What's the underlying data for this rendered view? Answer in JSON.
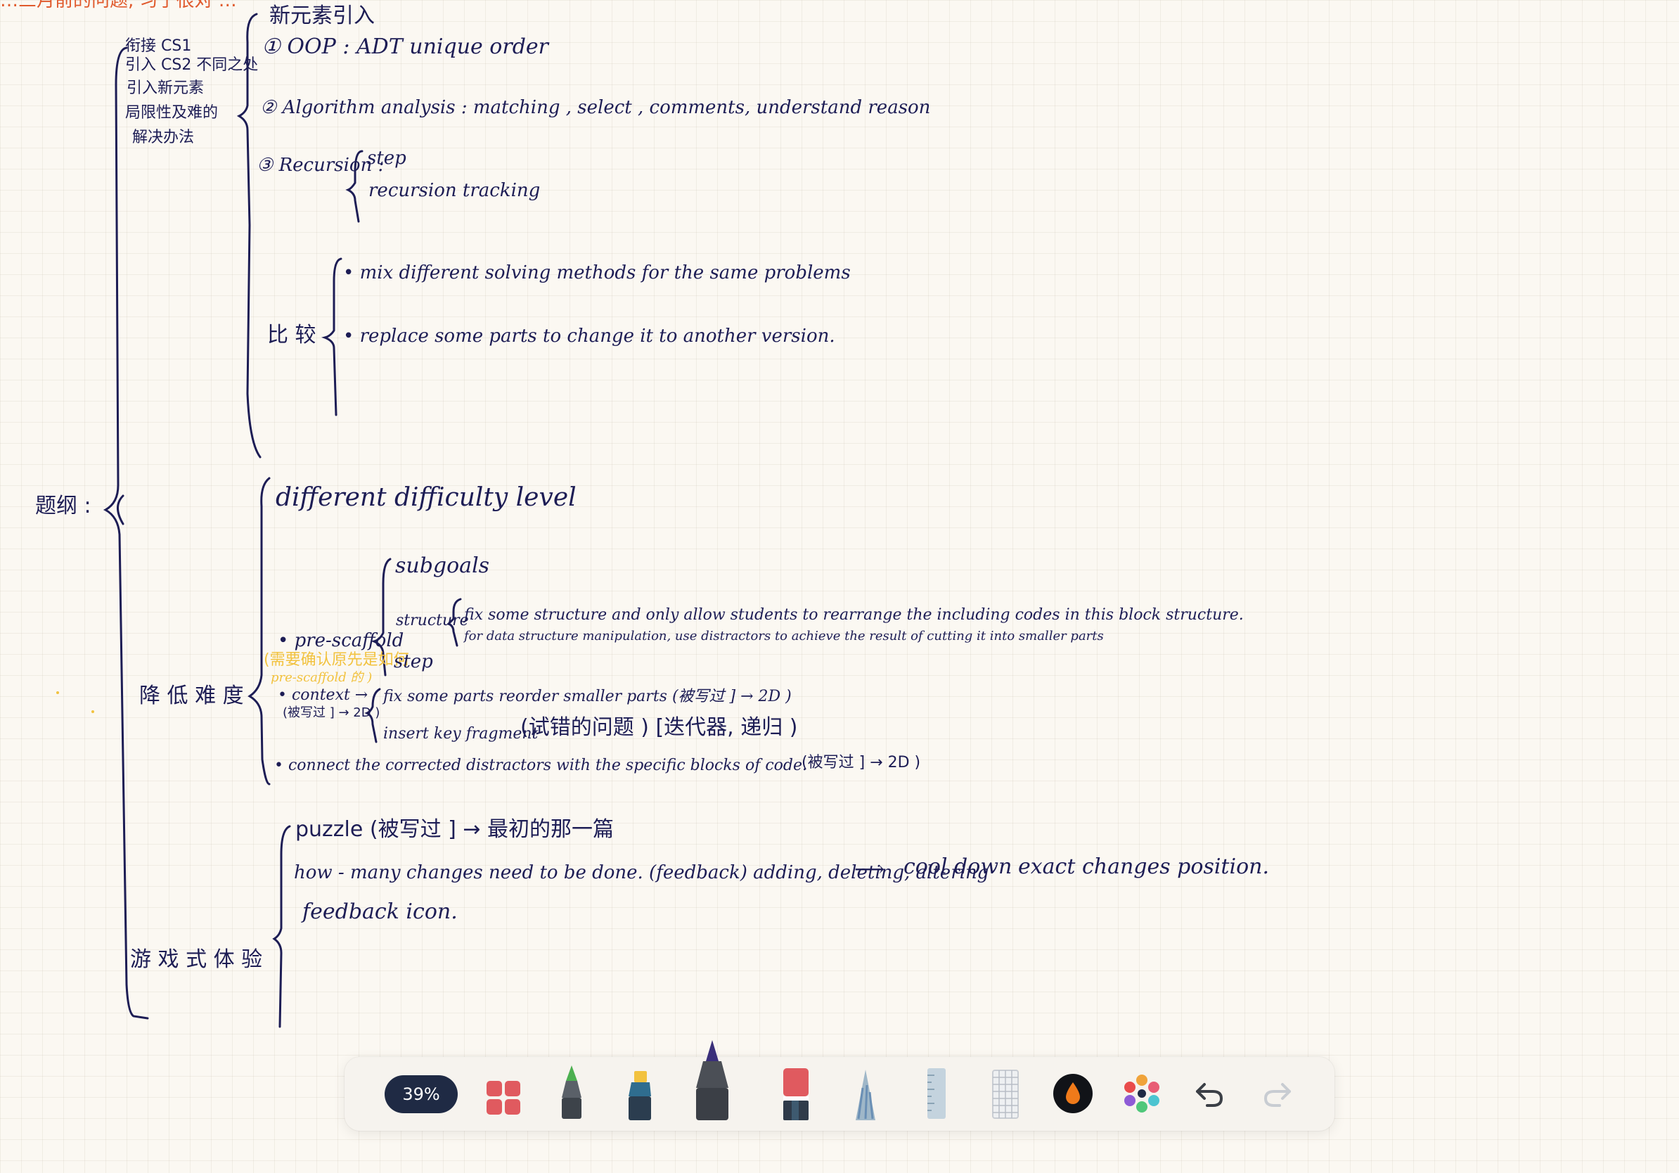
{
  "notes": {
    "top_cut": "…三月前的问题, 习了很对 …",
    "root_label": "题纲 :",
    "group_a": {
      "intro_lines": [
        "衔接 CS1",
        "引入 CS2 不同之处",
        "引入新元素",
        "局限性及难的",
        "解决办法"
      ],
      "heading": "新元素引入",
      "oop": "① OOP :   ADT     unique  order",
      "algorithm": "② Algorithm  analysis :   matching ,  select ,  comments,  understand  reason",
      "recursion_label": "③ Recursion :",
      "recursion_step": "step",
      "recursion_tracking": "recursion  tracking",
      "compare_label": "比 较",
      "compare_item_1": "•  mix  different  solving  methods  for  the  same  problems",
      "compare_item_2": "•  replace  some  parts  to  change  it  to  another  version."
    },
    "group_b": {
      "label": "降 低 难 度",
      "difficulty": "different  difficulty  level",
      "prescaffold": "• pre-scaffold",
      "prescaffold_note_1": "(需要确认原先是如何",
      "prescaffold_note_2": "pre-scaffold 的 )",
      "subgoals": "subgoals",
      "structure": "structure",
      "structure_line_1": "fix  some  structure  and  only  allow  students  to  rearrange  the  including  codes  in  this  block  structure.",
      "structure_line_2": "for data structure manipulation,  use distractors  to achieve  the result  of cutting  it into  smaller parts",
      "step": "step",
      "context": "• context  →",
      "context_note": "(被写过 ] → 2D )",
      "fix_parts": "fix  some  parts    reorder  smaller parts (被写过 ] → 2D )",
      "insert_fragment": "insert  key  fragment",
      "trial_error": "(试错的问题 ) [迭代器, 递归 )",
      "connect": "•  connect  the  corrected  distractors  with  the  specific  blocks  of  code.",
      "connect_note": "(被写过 ] → 2D )"
    },
    "group_c": {
      "label": "游 戏 式 体 验",
      "puzzle": "puzzle (被写过 ] → 最初的那一篇",
      "changes": "how - many  changes  need  to  be  done. (feedback)  adding, deleting, altering",
      "arrow": "⟶",
      "cooldown": "cool  down",
      "exact": "exact  changes  position.",
      "feedback": "feedback  icon."
    }
  },
  "toolbar": {
    "zoom_label": "39%",
    "tools": [
      {
        "name": "pages-grid-icon",
        "color": "#e05a5f"
      },
      {
        "name": "green-marker-icon",
        "color": "#4caf50"
      },
      {
        "name": "yellow-highlighter-icon",
        "color": "#f2c23f"
      },
      {
        "name": "purple-pen-icon",
        "color": "#3a2f7a"
      },
      {
        "name": "eraser-icon",
        "color": "#e05a5f"
      },
      {
        "name": "pencil-icon",
        "color": "#6a8fb5"
      },
      {
        "name": "ruler-icon",
        "color": "#9fb7c8"
      },
      {
        "name": "grid-paper-icon",
        "color": "#c9cdd3"
      },
      {
        "name": "ink-color-icon",
        "color": "#f07a1a"
      },
      {
        "name": "color-palette-icon",
        "color": "#e85d75"
      },
      {
        "name": "undo-icon",
        "color": "#3b3f46"
      },
      {
        "name": "redo-icon",
        "color": "#c8ccd2"
      }
    ]
  }
}
